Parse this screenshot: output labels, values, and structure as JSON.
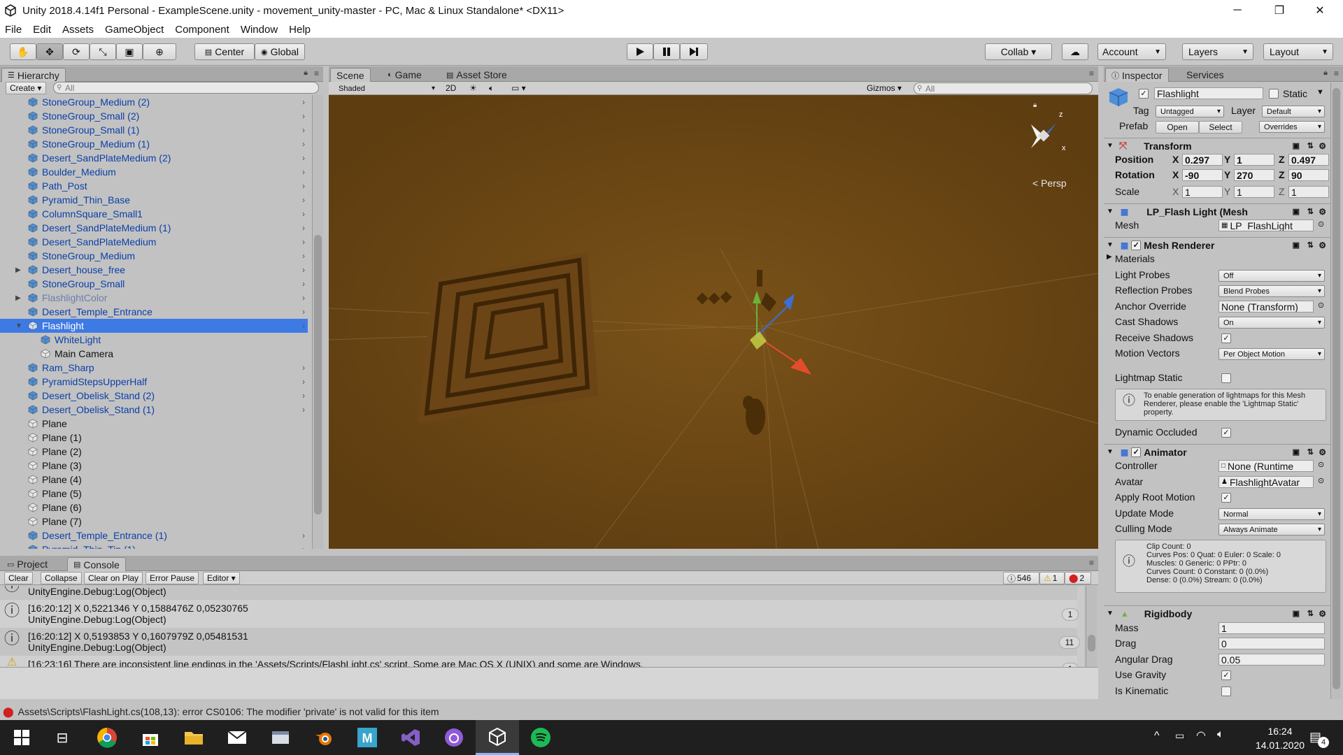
{
  "window": {
    "title": "Unity 2018.4.14f1 Personal - ExampleScene.unity - movement_unity-master - PC, Mac & Linux Standalone* <DX11>",
    "minimize": "─",
    "maximize": "❐",
    "close": "✕"
  },
  "menu": [
    "File",
    "Edit",
    "Assets",
    "GameObject",
    "Component",
    "Window",
    "Help"
  ],
  "toolbar": {
    "pivot": "Center",
    "space": "Global",
    "collab": "Collab ▾",
    "account": "Account",
    "layers": "Layers",
    "layout": "Layout"
  },
  "hierarchy": {
    "tab": "Hierarchy",
    "create": "Create ▾",
    "search_placeholder": "All",
    "items": [
      {
        "label": "StoneGroup_Medium (2)",
        "style": "prefab",
        "indent": 0
      },
      {
        "label": "StoneGroup_Small (2)",
        "style": "prefab",
        "indent": 0
      },
      {
        "label": "StoneGroup_Small (1)",
        "style": "prefab",
        "indent": 0
      },
      {
        "label": "StoneGroup_Medium (1)",
        "style": "prefab",
        "indent": 0
      },
      {
        "label": "Desert_SandPlateMedium (2)",
        "style": "prefab",
        "indent": 0
      },
      {
        "label": "Boulder_Medium",
        "style": "prefab",
        "indent": 0
      },
      {
        "label": "Path_Post",
        "style": "prefab",
        "indent": 0
      },
      {
        "label": "Pyramid_Thin_Base",
        "style": "prefab",
        "indent": 0
      },
      {
        "label": "ColumnSquare_Small1",
        "style": "prefab",
        "indent": 0
      },
      {
        "label": "Desert_SandPlateMedium (1)",
        "style": "prefab",
        "indent": 0
      },
      {
        "label": "Desert_SandPlateMedium",
        "style": "prefab",
        "indent": 0
      },
      {
        "label": "StoneGroup_Medium",
        "style": "prefab",
        "indent": 0
      },
      {
        "label": "Desert_house_free",
        "style": "prefab",
        "indent": 0,
        "fold": "▶"
      },
      {
        "label": "StoneGroup_Small",
        "style": "prefab",
        "indent": 0
      },
      {
        "label": "FlashlightColor",
        "style": "grey",
        "indent": 0,
        "fold": "▶"
      },
      {
        "label": "Desert_Temple_Entrance",
        "style": "prefab",
        "indent": 0
      },
      {
        "label": "Flashlight",
        "style": "selected",
        "indent": 0,
        "fold": "▼"
      },
      {
        "label": "WhiteLight",
        "style": "prefab",
        "indent": 1
      },
      {
        "label": "Main Camera",
        "style": "plain",
        "indent": 1
      },
      {
        "label": "Ram_Sharp",
        "style": "prefab",
        "indent": 0
      },
      {
        "label": "PyramidStepsUpperHalf",
        "style": "prefab",
        "indent": 0
      },
      {
        "label": "Desert_Obelisk_Stand (2)",
        "style": "prefab",
        "indent": 0
      },
      {
        "label": "Desert_Obelisk_Stand (1)",
        "style": "prefab",
        "indent": 0
      },
      {
        "label": "Plane",
        "style": "plain",
        "indent": 0
      },
      {
        "label": "Plane (1)",
        "style": "plain",
        "indent": 0
      },
      {
        "label": "Plane (2)",
        "style": "plain",
        "indent": 0
      },
      {
        "label": "Plane (3)",
        "style": "plain",
        "indent": 0
      },
      {
        "label": "Plane (4)",
        "style": "plain",
        "indent": 0
      },
      {
        "label": "Plane (5)",
        "style": "plain",
        "indent": 0
      },
      {
        "label": "Plane (6)",
        "style": "plain",
        "indent": 0
      },
      {
        "label": "Plane (7)",
        "style": "plain",
        "indent": 0
      },
      {
        "label": "Desert_Temple_Entrance (1)",
        "style": "prefab",
        "indent": 0
      },
      {
        "label": "Pyramid_Thin_Tip (1)",
        "style": "prefab",
        "indent": 0
      }
    ]
  },
  "scene": {
    "tabs": [
      "Scene",
      "Game",
      "Asset Store"
    ],
    "shading": "Shaded",
    "mode_2d": "2D",
    "gizmos": "Gizmos ▾",
    "search_placeholder": "All",
    "persp": "< Persp",
    "axis_x": "x",
    "axis_z": "z"
  },
  "inspector": {
    "tabs": [
      "Inspector",
      "Services"
    ],
    "name": "Flashlight",
    "static": "Static",
    "tag_label": "Tag",
    "tag": "Untagged",
    "layer_label": "Layer",
    "layer": "Default",
    "prefab_label": "Prefab",
    "open": "Open",
    "select": "Select",
    "overrides": "Overrides",
    "transform": {
      "title": "Transform",
      "position_label": "Position",
      "rotation_label": "Rotation",
      "scale_label": "Scale",
      "position": [
        "0.297",
        "1",
        "0.497"
      ],
      "rotation": [
        "-90",
        "270",
        "90"
      ],
      "scale": [
        "1",
        "1",
        "1"
      ]
    },
    "mesh_filter": {
      "title": "LP_Flash Light (Mesh",
      "mesh_label": "Mesh",
      "mesh": "LP_FlashLight"
    },
    "mesh_renderer": {
      "title": "Mesh Renderer",
      "materials": "Materials",
      "light_probes_label": "Light Probes",
      "light_probes": "Off",
      "reflection_probes_label": "Reflection Probes",
      "reflection_probes": "Blend Probes",
      "anchor_override_label": "Anchor Override",
      "anchor_override": "None (Transform)",
      "cast_shadows_label": "Cast Shadows",
      "cast_shadows": "On",
      "receive_shadows_label": "Receive Shadows",
      "motion_vectors_label": "Motion Vectors",
      "motion_vectors": "Per Object Motion",
      "lightmap_static_label": "Lightmap Static",
      "help": "To enable generation of lightmaps for this Mesh Renderer, please enable the 'Lightmap Static' property.",
      "dynamic_occluded_label": "Dynamic Occluded"
    },
    "animator": {
      "title": "Animator",
      "controller_label": "Controller",
      "controller": "None (Runtime",
      "avatar_label": "Avatar",
      "avatar": "FlashlightAvatar",
      "apply_root_motion_label": "Apply Root Motion",
      "update_mode_label": "Update Mode",
      "update_mode": "Normal",
      "culling_mode_label": "Culling Mode",
      "culling_mode": "Always Animate",
      "stats": [
        "Clip Count: 0",
        "Curves Pos: 0 Quat: 0 Euler: 0 Scale: 0",
        "Muscles: 0 Generic: 0 PPtr: 0",
        "Curves Count: 0 Constant: 0 (0.0%)",
        "Dense: 0 (0.0%) Stream: 0 (0.0%)"
      ]
    },
    "rigidbody": {
      "title": "Rigidbody",
      "mass_label": "Mass",
      "mass": "1",
      "drag_label": "Drag",
      "drag": "0",
      "angular_drag_label": "Angular Drag",
      "angular_drag": "0.05",
      "use_gravity_label": "Use Gravity",
      "is_kinematic_label": "Is Kinematic"
    }
  },
  "console": {
    "tabs": [
      "Project",
      "Console"
    ],
    "buttons": [
      "Clear",
      "Collapse",
      "Clear on Play",
      "Error Pause",
      "Editor ▾"
    ],
    "log_count": "546",
    "warn_count": "1",
    "error_count": "2",
    "rows": [
      {
        "line1": "",
        "line2": "UnityEngine.Debug:Log(Object)",
        "count": ""
      },
      {
        "line1": "[16:20:12] X 0,5221346 Y 0,1588476Z 0,05230765",
        "line2": "UnityEngine.Debug:Log(Object)",
        "count": "1"
      },
      {
        "line1": "[16:20:12] X 0,5193853 Y 0,1607979Z 0,05481531",
        "line2": "UnityEngine.Debug:Log(Object)",
        "count": "11"
      },
      {
        "line1": "[16:23:16] There are inconsistent line endings in the 'Assets/Scripts/FlashLight.cs' script. Some are Mac OS X (UNIX) and some are Windows.",
        "line2": "",
        "count": "1"
      }
    ]
  },
  "statusbar": {
    "text": "Assets\\Scripts\\FlashLight.cs(108,13): error CS0106: The modifier 'private' is not valid for this item"
  },
  "taskbar": {
    "time": "16:24",
    "date": "14.01.2020",
    "notifications": "4"
  },
  "colors": {
    "accent": "#3e7ae4",
    "scene_bg": "#6a4614",
    "prefab_text": "#0b3fa8",
    "error": "#d12020"
  }
}
